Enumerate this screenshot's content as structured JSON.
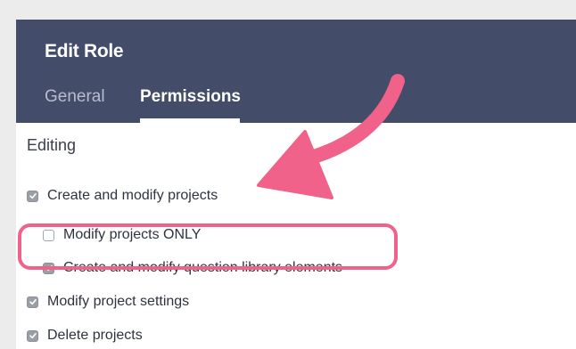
{
  "dialog": {
    "title": "Edit Role",
    "tabs": [
      {
        "label": "General",
        "active": false
      },
      {
        "label": "Permissions",
        "active": true
      }
    ]
  },
  "permissions": {
    "section_title": "Editing",
    "items": [
      {
        "label": "Create and modify projects",
        "checked": true
      },
      {
        "label": "Modify projects ONLY",
        "checked": false
      },
      {
        "label": "Create and modify question library elements",
        "checked": true
      },
      {
        "label": "Modify project settings",
        "checked": true
      },
      {
        "label": "Delete projects",
        "checked": true
      }
    ]
  },
  "annotation": {
    "highlight_color": "#f0628a",
    "arrow_color": "#f0628a"
  },
  "colors": {
    "header_bg": "#434c69",
    "checkbox_checked": "#9a9ea6"
  }
}
